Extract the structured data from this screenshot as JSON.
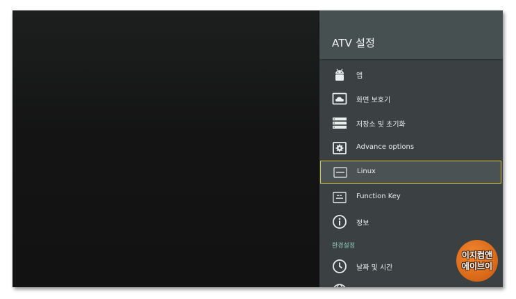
{
  "panel": {
    "title": "ATV 설정",
    "items": [
      {
        "label": "앱",
        "icon": "android-icon"
      },
      {
        "label": "화면 보호기",
        "icon": "screensaver-icon"
      },
      {
        "label": "저장소 및 초기화",
        "icon": "storage-icon"
      },
      {
        "label": "Advance options",
        "icon": "gear-box-icon"
      },
      {
        "label": "Linux",
        "icon": "linux-icon"
      },
      {
        "label": "Function Key",
        "icon": "fn-key-icon"
      },
      {
        "label": "정보",
        "icon": "info-icon"
      }
    ],
    "section_header": "환경설정",
    "prefs_items": [
      {
        "label": "날짜 및 시간",
        "icon": "clock-icon"
      }
    ],
    "selected_index": 4
  },
  "watermark": {
    "line1": "이지컴앤",
    "line2": "에이브이"
  },
  "colors": {
    "panel_bg": "#3b4142",
    "header_bg": "#475051",
    "selection_border": "#d8c94a",
    "section_header": "#8fc7b6",
    "badge": "#e0701f"
  }
}
